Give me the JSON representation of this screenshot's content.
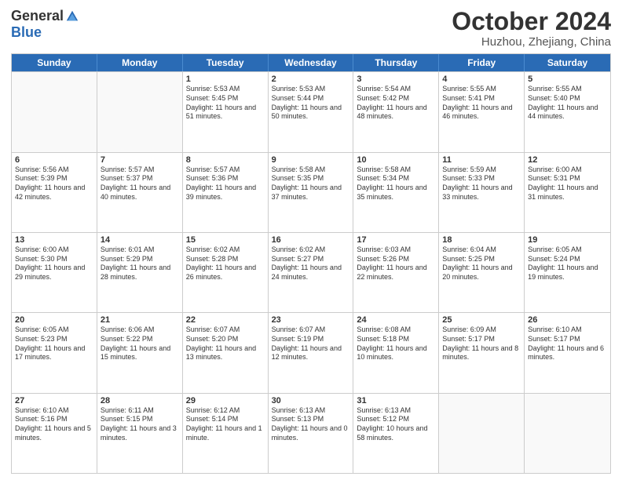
{
  "header": {
    "logo_general": "General",
    "logo_blue": "Blue",
    "month_title": "October 2024",
    "subtitle": "Huzhou, Zhejiang, China"
  },
  "weekdays": [
    "Sunday",
    "Monday",
    "Tuesday",
    "Wednesday",
    "Thursday",
    "Friday",
    "Saturday"
  ],
  "weeks": [
    [
      {
        "day": "",
        "info": "",
        "empty": true
      },
      {
        "day": "",
        "info": "",
        "empty": true
      },
      {
        "day": "1",
        "info": "Sunrise: 5:53 AM\nSunset: 5:45 PM\nDaylight: 11 hours and 51 minutes."
      },
      {
        "day": "2",
        "info": "Sunrise: 5:53 AM\nSunset: 5:44 PM\nDaylight: 11 hours and 50 minutes."
      },
      {
        "day": "3",
        "info": "Sunrise: 5:54 AM\nSunset: 5:42 PM\nDaylight: 11 hours and 48 minutes."
      },
      {
        "day": "4",
        "info": "Sunrise: 5:55 AM\nSunset: 5:41 PM\nDaylight: 11 hours and 46 minutes."
      },
      {
        "day": "5",
        "info": "Sunrise: 5:55 AM\nSunset: 5:40 PM\nDaylight: 11 hours and 44 minutes."
      }
    ],
    [
      {
        "day": "6",
        "info": "Sunrise: 5:56 AM\nSunset: 5:39 PM\nDaylight: 11 hours and 42 minutes."
      },
      {
        "day": "7",
        "info": "Sunrise: 5:57 AM\nSunset: 5:37 PM\nDaylight: 11 hours and 40 minutes."
      },
      {
        "day": "8",
        "info": "Sunrise: 5:57 AM\nSunset: 5:36 PM\nDaylight: 11 hours and 39 minutes."
      },
      {
        "day": "9",
        "info": "Sunrise: 5:58 AM\nSunset: 5:35 PM\nDaylight: 11 hours and 37 minutes."
      },
      {
        "day": "10",
        "info": "Sunrise: 5:58 AM\nSunset: 5:34 PM\nDaylight: 11 hours and 35 minutes."
      },
      {
        "day": "11",
        "info": "Sunrise: 5:59 AM\nSunset: 5:33 PM\nDaylight: 11 hours and 33 minutes."
      },
      {
        "day": "12",
        "info": "Sunrise: 6:00 AM\nSunset: 5:31 PM\nDaylight: 11 hours and 31 minutes."
      }
    ],
    [
      {
        "day": "13",
        "info": "Sunrise: 6:00 AM\nSunset: 5:30 PM\nDaylight: 11 hours and 29 minutes."
      },
      {
        "day": "14",
        "info": "Sunrise: 6:01 AM\nSunset: 5:29 PM\nDaylight: 11 hours and 28 minutes."
      },
      {
        "day": "15",
        "info": "Sunrise: 6:02 AM\nSunset: 5:28 PM\nDaylight: 11 hours and 26 minutes."
      },
      {
        "day": "16",
        "info": "Sunrise: 6:02 AM\nSunset: 5:27 PM\nDaylight: 11 hours and 24 minutes."
      },
      {
        "day": "17",
        "info": "Sunrise: 6:03 AM\nSunset: 5:26 PM\nDaylight: 11 hours and 22 minutes."
      },
      {
        "day": "18",
        "info": "Sunrise: 6:04 AM\nSunset: 5:25 PM\nDaylight: 11 hours and 20 minutes."
      },
      {
        "day": "19",
        "info": "Sunrise: 6:05 AM\nSunset: 5:24 PM\nDaylight: 11 hours and 19 minutes."
      }
    ],
    [
      {
        "day": "20",
        "info": "Sunrise: 6:05 AM\nSunset: 5:23 PM\nDaylight: 11 hours and 17 minutes."
      },
      {
        "day": "21",
        "info": "Sunrise: 6:06 AM\nSunset: 5:22 PM\nDaylight: 11 hours and 15 minutes."
      },
      {
        "day": "22",
        "info": "Sunrise: 6:07 AM\nSunset: 5:20 PM\nDaylight: 11 hours and 13 minutes."
      },
      {
        "day": "23",
        "info": "Sunrise: 6:07 AM\nSunset: 5:19 PM\nDaylight: 11 hours and 12 minutes."
      },
      {
        "day": "24",
        "info": "Sunrise: 6:08 AM\nSunset: 5:18 PM\nDaylight: 11 hours and 10 minutes."
      },
      {
        "day": "25",
        "info": "Sunrise: 6:09 AM\nSunset: 5:17 PM\nDaylight: 11 hours and 8 minutes."
      },
      {
        "day": "26",
        "info": "Sunrise: 6:10 AM\nSunset: 5:17 PM\nDaylight: 11 hours and 6 minutes."
      }
    ],
    [
      {
        "day": "27",
        "info": "Sunrise: 6:10 AM\nSunset: 5:16 PM\nDaylight: 11 hours and 5 minutes."
      },
      {
        "day": "28",
        "info": "Sunrise: 6:11 AM\nSunset: 5:15 PM\nDaylight: 11 hours and 3 minutes."
      },
      {
        "day": "29",
        "info": "Sunrise: 6:12 AM\nSunset: 5:14 PM\nDaylight: 11 hours and 1 minute."
      },
      {
        "day": "30",
        "info": "Sunrise: 6:13 AM\nSunset: 5:13 PM\nDaylight: 11 hours and 0 minutes."
      },
      {
        "day": "31",
        "info": "Sunrise: 6:13 AM\nSunset: 5:12 PM\nDaylight: 10 hours and 58 minutes."
      },
      {
        "day": "",
        "info": "",
        "empty": true
      },
      {
        "day": "",
        "info": "",
        "empty": true
      }
    ]
  ]
}
